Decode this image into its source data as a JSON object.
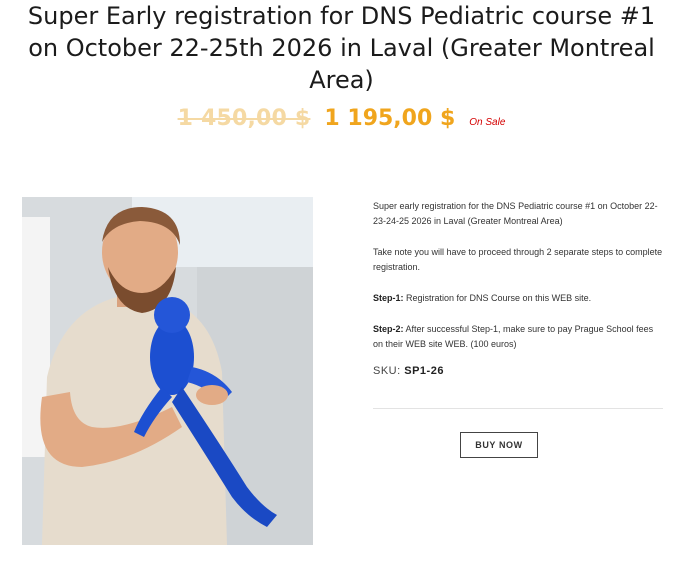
{
  "product": {
    "title": "Super Early registration for DNS Pediatric course #1 on October 22-25th 2026 in Laval (Greater Montreal Area)",
    "price_old": "1 450,00 $",
    "price_new": "1 195,00 $",
    "sale_badge": "On Sale",
    "image_icon": "instructor-photo"
  },
  "description": {
    "intro": "Super early registration for the DNS Pediatric course #1 on October 22-23-24-25 2026 in Laval (Greater Montreal Area)",
    "note": "Take note you will have to proceed through 2 separate steps to complete registration.",
    "step1_label": "Step-1:",
    "step1_text": " Registration for DNS Course on this WEB site.",
    "step2_label": "Step-2:",
    "step2_text": " After successful Step-1, make sure to pay Prague School fees on their WEB site WEB. (100 euros)"
  },
  "sku": {
    "label": "SKU:",
    "value": "SP1-26"
  },
  "actions": {
    "buy_now": "BUY NOW"
  },
  "colors": {
    "price_new": "#f0a51d",
    "price_old": "#f5d9a3",
    "sale_badge": "#d40000"
  }
}
